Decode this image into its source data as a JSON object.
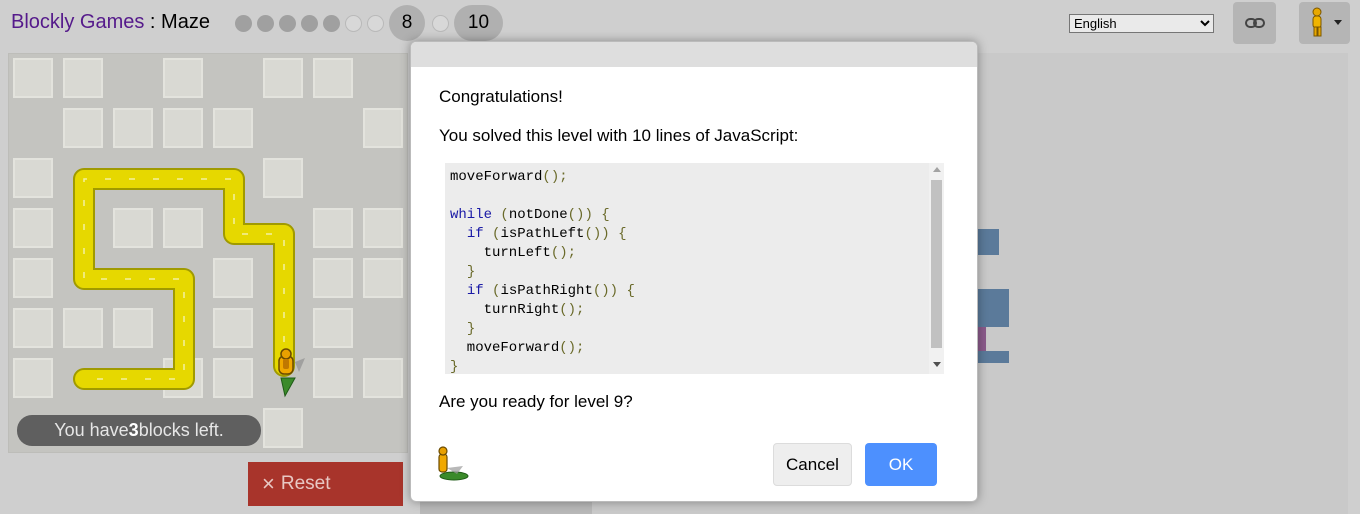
{
  "header": {
    "brand": "Blockly Games",
    "separator": " : ",
    "game": "Maze",
    "levels": [
      {
        "label": "",
        "state": "done"
      },
      {
        "label": "",
        "state": "done"
      },
      {
        "label": "",
        "state": "done"
      },
      {
        "label": "",
        "state": "done"
      },
      {
        "label": "",
        "state": "done"
      },
      {
        "label": "",
        "state": "todo"
      },
      {
        "label": "",
        "state": "todo"
      },
      {
        "label": "8",
        "state": "current"
      },
      {
        "label": "",
        "state": "todo"
      },
      {
        "label": "10",
        "state": "available"
      }
    ],
    "language": {
      "selected": "English"
    },
    "icons": {
      "link": "link-icon",
      "pegman": "pegman-icon",
      "dropdown": "dropdown-arrow-icon"
    }
  },
  "maze": {
    "counter_prefix": "You have ",
    "counter_count": "3",
    "counter_suffix": " blocks left."
  },
  "controls": {
    "reset_icon": "×",
    "reset_label": "Reset"
  },
  "dialog": {
    "congrats": "Congratulations!",
    "solved": "You solved this level with 10 lines of JavaScript:",
    "ready": "Are you ready for level 9?",
    "cancel_label": "Cancel",
    "ok_label": "OK"
  },
  "colors": {
    "brand": "#551a8b",
    "path": "#e6d800",
    "ok_button": "#4d90fe",
    "reset_button": "#a8342b",
    "keyword": "#1a1aa6"
  }
}
